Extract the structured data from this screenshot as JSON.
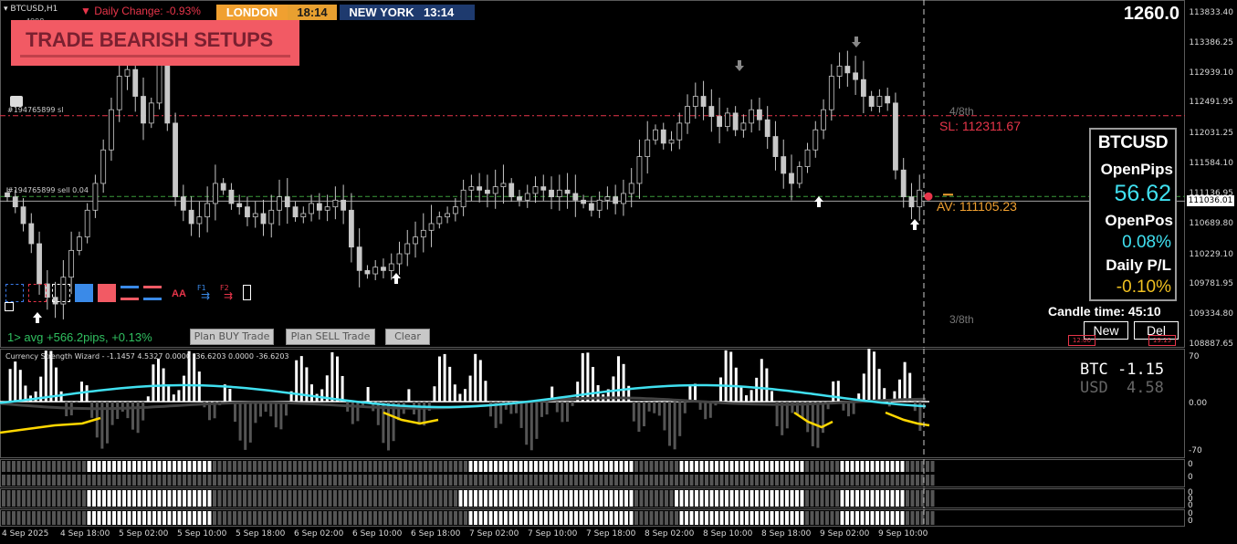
{
  "header": {
    "symbol_tf": "BTCUSD,H1",
    "daily_change": "Daily Change: -0.93%",
    "london_label": "LONDON",
    "london_time": "18:14",
    "newyork_label": "NEW YORK",
    "newyork_time": "13:14",
    "sub_text": "4998",
    "spread_value": "1260.0"
  },
  "banner": {
    "text": "TRADE BEARISH SETUPS"
  },
  "chart_data": {
    "type": "candlestick",
    "symbol": "BTCUSD",
    "timeframe": "H1",
    "y_ticks": [
      113833.4,
      113386.25,
      112939.1,
      112491.95,
      112031.25,
      111584.1,
      111136.95,
      110689.8,
      110229.1,
      109781.95,
      109334.8,
      108887.65
    ],
    "ylim": [
      108887.65,
      113833.4
    ],
    "current_price_label": "111036.01",
    "x_labels": [
      "4 Sep 2025",
      "4 Sep 18:00",
      "5 Sep 02:00",
      "5 Sep 10:00",
      "5 Sep 18:00",
      "6 Sep 02:00",
      "6 Sep 10:00",
      "6 Sep 18:00",
      "7 Sep 02:00",
      "7 Sep 10:00",
      "7 Sep 18:00",
      "8 Sep 02:00",
      "8 Sep 10:00",
      "8 Sep 18:00",
      "9 Sep 02:00",
      "9 Sep 10:00"
    ],
    "closes": [
      111100,
      110950,
      110700,
      110400,
      109800,
      109600,
      109500,
      109900,
      110300,
      110500,
      110900,
      111300,
      111800,
      112400,
      112900,
      113000,
      112600,
      112200,
      112500,
      113200,
      112200,
      111100,
      110900,
      110700,
      110800,
      111000,
      111300,
      111200,
      111000,
      110950,
      110800,
      110850,
      110700,
      110900,
      111100,
      110950,
      110800,
      110850,
      111000,
      110900,
      110950,
      111050,
      110900,
      110350,
      110000,
      109950,
      110050,
      110000,
      110100,
      110250,
      110400,
      110500,
      110600,
      110700,
      110800,
      110850,
      110950,
      111200,
      111250,
      111200,
      111150,
      111250,
      111300,
      111100,
      111050,
      111150,
      111250,
      111200,
      111100,
      111200,
      111150,
      111050,
      111000,
      110900,
      111050,
      111100,
      111000,
      111150,
      111300,
      111700,
      111950,
      112100,
      111900,
      111950,
      112200,
      112450,
      112600,
      112450,
      112300,
      112150,
      112350,
      112100,
      112200,
      112400,
      112250,
      112000,
      111700,
      111450,
      111300,
      111550,
      111800,
      112100,
      112400,
      112900,
      113050,
      112950,
      112850,
      112600,
      112450,
      112600,
      112500,
      111500,
      111100,
      110950,
      111200
    ]
  },
  "trade_lines": {
    "sl_order_label": "#194765899 sl",
    "sell_order_label": "#194765899 sell 0.04",
    "sl_text": "SL: 112311.67",
    "av_text": "AV: 111105.23",
    "murrey_top": "4/8th",
    "murrey_bottom": "3/8th"
  },
  "info_panel": {
    "title": "BTCUSD",
    "open_pips_label": "OpenPips",
    "open_pips_value": "56.62",
    "open_pos_label": "OpenPos",
    "open_pos_value": "0.08%",
    "daily_pl_label": "Daily P/L",
    "daily_pl_value": "-0.10%"
  },
  "candle_time": {
    "label": "Candle time:",
    "value": "45:10"
  },
  "buttons": {
    "new": "New",
    "del": "Del",
    "plan_buy": "Plan BUY Trade",
    "plan_sell": "Plan SELL Trade",
    "clear": "Clear"
  },
  "toolbar": {
    "f1": "F1",
    "f2": "F2",
    "aa": "AA"
  },
  "avg_text": "1> avg +566.2pips, +0.13%",
  "mini_labels": {
    "left": "12:00",
    "right": "19:15"
  },
  "strength_panel": {
    "title": "Currency Strength Wizard - -1.1457 4.5327 0.0000 -36.6203 0.0000 -36.6203",
    "btc_label": "BTC",
    "btc_value": "-1.15",
    "usd_label": "USD",
    "usd_value": "4.58",
    "ticks": [
      "70",
      "0.00",
      "-70"
    ]
  },
  "bar_panels": {
    "p1_ticks": [
      "0",
      "0"
    ],
    "p2_ticks": [
      "0",
      "0",
      "0"
    ],
    "p3_ticks": [
      "0",
      "0"
    ]
  },
  "colors": {
    "bearish": "#e8354a",
    "av": "#f0a030",
    "cyan": "#40e0f0",
    "yellow": "#ffd700",
    "london_bg": "#f0a030",
    "ny_bg": "#1e3a6e"
  }
}
